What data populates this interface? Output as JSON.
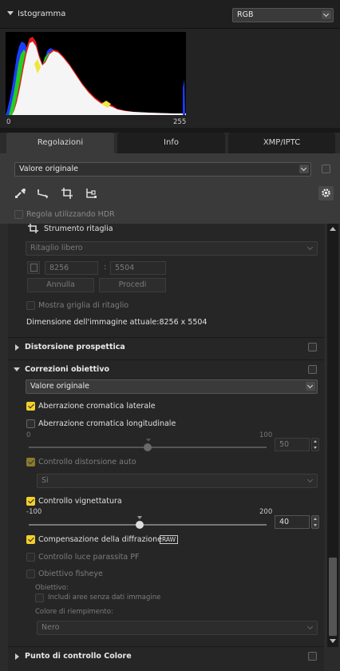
{
  "histogram": {
    "title": "Istogramma",
    "channel": "RGB",
    "min_label": "0",
    "max_label": "255"
  },
  "tabs": [
    {
      "label": "Regolazioni",
      "active": true
    },
    {
      "label": "Info",
      "active": false
    },
    {
      "label": "XMP/IPTC",
      "active": false
    }
  ],
  "preset": {
    "value": "Valore originale"
  },
  "toolbar": {
    "icons": [
      "eyedropper-icon",
      "straighten-icon",
      "crop-icon",
      "tree-icon",
      "gear-icon"
    ]
  },
  "hdr": {
    "label": "Regola utilizzando HDR"
  },
  "crop": {
    "title": "Strumento ritaglia",
    "ratio": "Ritaglio libero",
    "width": "8256",
    "separator": ":",
    "height": "5504",
    "cancel_label": "Annulla",
    "apply_label": "Procedi",
    "grid_label": "Mostra griglia di ritaglio",
    "size_text": "Dimensione dell'immagine attuale:8256 x 5504"
  },
  "perspective": {
    "title": "Distorsione prospettica"
  },
  "lens": {
    "title": "Correzioni obiettivo",
    "preset": "Valore originale",
    "lateral_ca": "Aberrazione cromatica laterale",
    "longitudinal_ca": "Aberrazione cromatica longitudinale",
    "long_min": "0",
    "long_max": "100",
    "long_value": "50",
    "auto_distortion": "Controllo distorsione auto",
    "auto_distortion_value": "Sì",
    "vignette": "Controllo vignettatura",
    "vig_min": "-100",
    "vig_max": "200",
    "vig_value": "40",
    "diffraction": "Compensazione della diffrazione",
    "raw_badge": "RAW",
    "flare": "Controllo luce parassita PF",
    "fisheye": "Obiettivo fisheye",
    "lens_label": "Obiettivo:",
    "include_label": "Includi aree senza dati immagine",
    "fill_label": "Colore di riempimento:",
    "fill_value": "Nero"
  },
  "color_point": {
    "title": "Punto di controllo Colore"
  },
  "colors": {
    "accent": "#f2cf2c",
    "panel": "#2b2b2b"
  }
}
